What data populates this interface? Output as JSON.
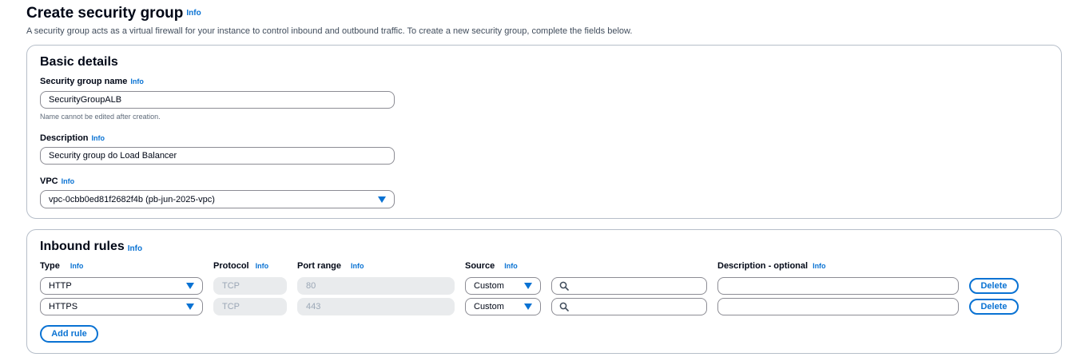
{
  "header": {
    "title": "Create security group",
    "info": "Info",
    "description": "A security group acts as a virtual firewall for your instance to control inbound and outbound traffic. To create a new security group, complete the fields below."
  },
  "basic_details": {
    "title": "Basic details",
    "name": {
      "label": "Security group name",
      "info": "Info",
      "value": "SecurityGroupALB",
      "hint": "Name cannot be edited after creation."
    },
    "description": {
      "label": "Description",
      "info": "Info",
      "value": "Security group do Load Balancer"
    },
    "vpc": {
      "label": "VPC",
      "info": "Info",
      "value": "vpc-0cbb0ed81f2682f4b (pb-jun-2025-vpc)"
    }
  },
  "inbound_rules": {
    "title": "Inbound rules",
    "info": "Info",
    "columns": {
      "type": "Type",
      "protocol": "Protocol",
      "port_range": "Port range",
      "source": "Source",
      "description": "Description - optional",
      "info": "Info"
    },
    "rows": [
      {
        "type": "HTTP",
        "protocol": "TCP",
        "port_range": "80",
        "source": "Custom",
        "source_value": "",
        "description": "",
        "delete": "Delete"
      },
      {
        "type": "HTTPS",
        "protocol": "TCP",
        "port_range": "443",
        "source": "Custom",
        "source_value": "",
        "description": "",
        "delete": "Delete"
      }
    ],
    "add_rule": "Add rule"
  },
  "colors": {
    "accent": "#0972d3",
    "border": "#8c8c94",
    "disabled_bg": "#e9ebed"
  },
  "icons": {
    "dropdown": "caret-down-icon",
    "search": "search-icon"
  }
}
